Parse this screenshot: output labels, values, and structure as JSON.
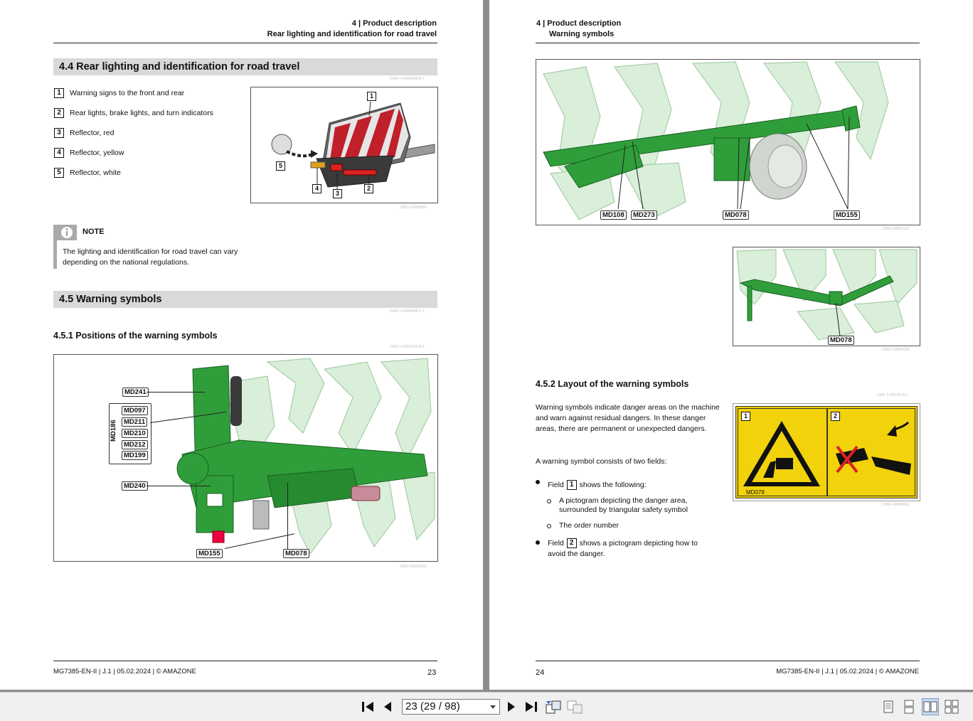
{
  "left_page": {
    "header_line1": "4 | Product description",
    "header_line2": "Rear lighting and identification for road travel",
    "section_44": "4.4  Rear lighting and identification for road travel",
    "ref_44": "CMS-T-00009148-B.1",
    "legend": [
      {
        "num": "1",
        "text": "Warning signs to the front and rear"
      },
      {
        "num": "2",
        "text": "Rear lights, brake lights, and turn indicators"
      },
      {
        "num": "3",
        "text": "Reflector, red"
      },
      {
        "num": "4",
        "text": "Reflector, yellow"
      },
      {
        "num": "5",
        "text": "Reflector, white"
      }
    ],
    "fig1_ref": "CMS-I-00006282",
    "fig1_callouts": [
      "1",
      "2",
      "3",
      "4",
      "5"
    ],
    "note_title": "NOTE",
    "note_icon": "info-icon",
    "note_text": "The lighting and identification for road travel can vary depending on the national regulations.",
    "section_45": "4.5  Warning symbols",
    "ref_45": "CMS-T-00006496-C.1",
    "section_451": "4.5.1  Positions of the warning symbols",
    "ref_451": "CMS-T-00007220-B.1",
    "fig2_tags": {
      "md241": "MD241",
      "group_label": "MD186",
      "md097": "MD097",
      "md211": "MD211",
      "md210": "MD210",
      "md212": "MD212",
      "md199": "MD199",
      "md240": "MD240",
      "md155": "MD155",
      "md078": "MD078"
    },
    "fig2_ref": "CMS-I-00009132",
    "footer_left": "MG7385-EN-II | J.1 | 05.02.2024 | © AMAZONE",
    "page_number": "23"
  },
  "right_page": {
    "header_line1": "4 | Product description",
    "header_line2": "Warning symbols",
    "fig3_tags": [
      "MD108",
      "MD273",
      "MD078",
      "MD155"
    ],
    "fig3_ref": "CMS-I-00005131",
    "fig4_tag": "MD078",
    "fig4_ref": "CMS-I-00005139",
    "section_452": "4.5.2  Layout of the warning symbols",
    "ref_452": "CMS-T-000141-D.1",
    "para1": "Warning symbols indicate danger areas on the machine and warn against residual dangers. In these danger areas, there are permanent or unexpected dangers.",
    "para2": "A warning symbol consists of two fields:",
    "field1_prefix": "Field",
    "field1_num": "1",
    "field1_suffix": "shows the following:",
    "sub1": "A pictogram depicting the danger area, surrounded by triangular safety symbol",
    "sub2": "The order number",
    "field2_prefix": "Field",
    "field2_num": "2",
    "field2_suffix": "shows a pictogram depicting how to avoid the danger.",
    "sign_field1": "1",
    "sign_field2": "2",
    "sign_order": "MD078",
    "sign_ref": "CMS-I-00000416",
    "footer_right": "MG7385-EN-II | J.1 | 05.02.2024 | © AMAZONE",
    "page_number": "24"
  },
  "toolbar": {
    "page_field": "23 (29 / 98)",
    "icons": [
      "first-page-icon",
      "previous-page-icon",
      "next-page-icon",
      "last-page-icon",
      "go-back-view-icon",
      "go-forward-view-icon",
      "single-page-icon",
      "continuous-icon",
      "facing-pages-icon",
      "continuous-facing-icon"
    ]
  },
  "colors": {
    "machine_green": "#2f9e3a",
    "warning_yellow": "#f2d20b",
    "section_bar": "#d9d9d9"
  }
}
